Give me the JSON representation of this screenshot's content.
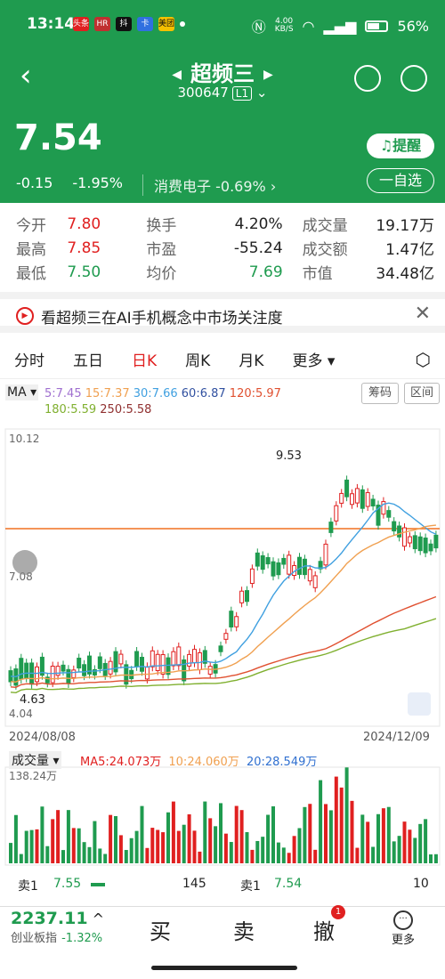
{
  "status": {
    "time": "13:14",
    "net_speed": "4.00\nKB/S",
    "battery": "56%",
    "apps": [
      "头条",
      "HR",
      "抖",
      "卡",
      "美团"
    ]
  },
  "nav": {
    "back": "<",
    "title": "超频三",
    "code": "300647",
    "level": "L1"
  },
  "quote": {
    "price": "7.54",
    "change": "-0.15",
    "change_pct": "-1.95%",
    "sector": "消费电子",
    "sector_pct": "-0.69%",
    "remind_label": "提醒",
    "watch_label": "一自选"
  },
  "stats": [
    {
      "k1": "今开",
      "v1": "7.80",
      "k2": "换手",
      "v2": "4.20%",
      "k3": "成交量",
      "v3": "19.17万"
    },
    {
      "k1": "最高",
      "v1": "7.85",
      "k2": "市盈",
      "v2": "-55.24",
      "k3": "成交额",
      "v3": "1.47亿"
    },
    {
      "k1": "最低",
      "v1": "7.50",
      "k2": "均价",
      "v2": "7.69",
      "k3": "市值",
      "v3": "34.48亿"
    }
  ],
  "banner": {
    "text": "看超频三在AI手机概念中市场关注度"
  },
  "tabs": [
    "分时",
    "五日",
    "日K",
    "周K",
    "月K",
    "更多"
  ],
  "chart": {
    "ma_label": "MA",
    "ma_values": [
      {
        "label": "5:7.45",
        "color": "#a070d0"
      },
      {
        "label": "15:7.37",
        "color": "#f0a050"
      },
      {
        "label": "30:7.66",
        "color": "#40a0e0"
      },
      {
        "label": "60:6.87",
        "color": "#3050a0"
      },
      {
        "label": "120:5.97",
        "color": "#e05030"
      },
      {
        "label": "180:5.59",
        "color": "#80b030"
      },
      {
        "label": "250:5.58",
        "color": "#903030"
      }
    ],
    "btn_chip": "筹码",
    "btn_interval": "区间",
    "y_top": "10.12",
    "y_mid": "7.08",
    "y_bot": "4.04",
    "high_mark": "9.53",
    "low_mark": "4.63",
    "date_start": "2024/08/08",
    "date_end": "2024/12/09",
    "volume_label": "成交量",
    "vol_ma5": "MA5:24.073万",
    "vol_ma10": "10:24.060万",
    "vol_ma20": "20:28.549万",
    "vol_top": "138.24万"
  },
  "orderbook": {
    "sell_label": "卖1",
    "sell_price": "7.55",
    "sell_vol": "145",
    "sell_label2": "卖1",
    "sell_price2": "7.54",
    "sell_vol2": "10"
  },
  "bottom": {
    "index_value": "2237.11",
    "index_name": "创业板指",
    "index_pct": "-1.32%",
    "buy": "买",
    "sell": "卖",
    "cancel": "撤",
    "cancel_badge": "1",
    "more": "更多"
  }
}
